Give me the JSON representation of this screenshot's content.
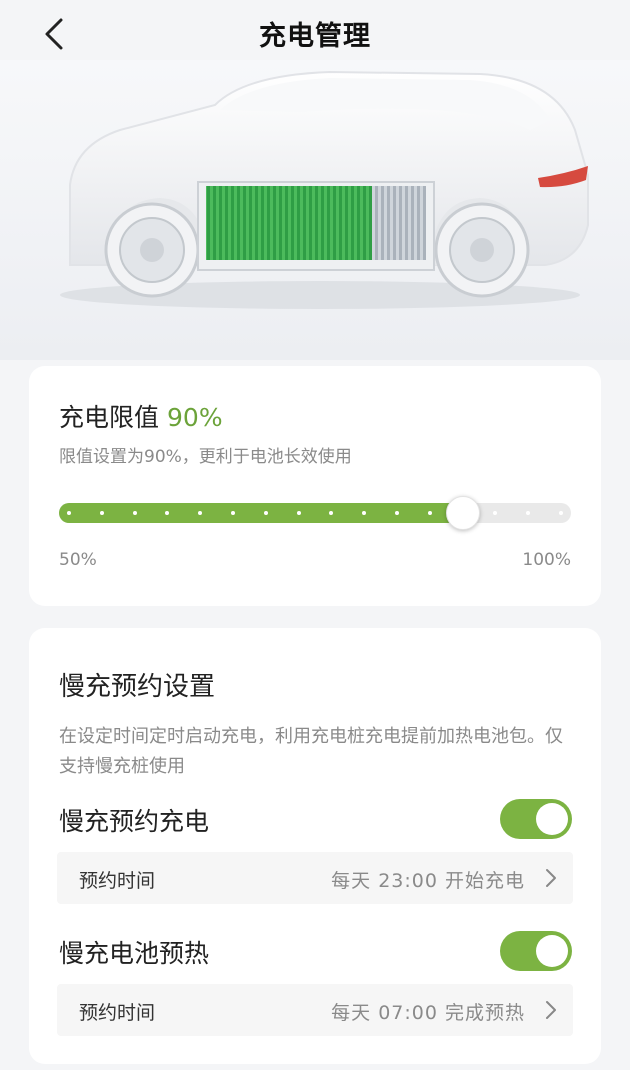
{
  "header": {
    "title": "充电管理",
    "back_icon": "chevron-left-icon"
  },
  "hero": {
    "image": "car-battery-illustration",
    "battery_fill_color": "#3aa64b"
  },
  "charge_limit": {
    "title": "充电限值",
    "value": "90%",
    "description": "限值设置为90%，更利于电池长效使用",
    "min_label": "50%",
    "max_label": "100%",
    "min": 50,
    "max": 100,
    "current": 90,
    "accent_color": "#7cb342"
  },
  "slow_charge": {
    "title": "慢充预约设置",
    "description": "在设定时间定时启动充电，利用充电桩充电提前加热电池包。仅支持慢充桩使用",
    "scheduled_charge": {
      "label": "慢充预约充电",
      "enabled": true,
      "time_label": "预约时间",
      "time_value": "每天 23:00 开始充电"
    },
    "battery_preheat": {
      "label": "慢充电池预热",
      "enabled": true,
      "time_label": "预约时间",
      "time_value": "每天 07:00 完成预热"
    }
  }
}
